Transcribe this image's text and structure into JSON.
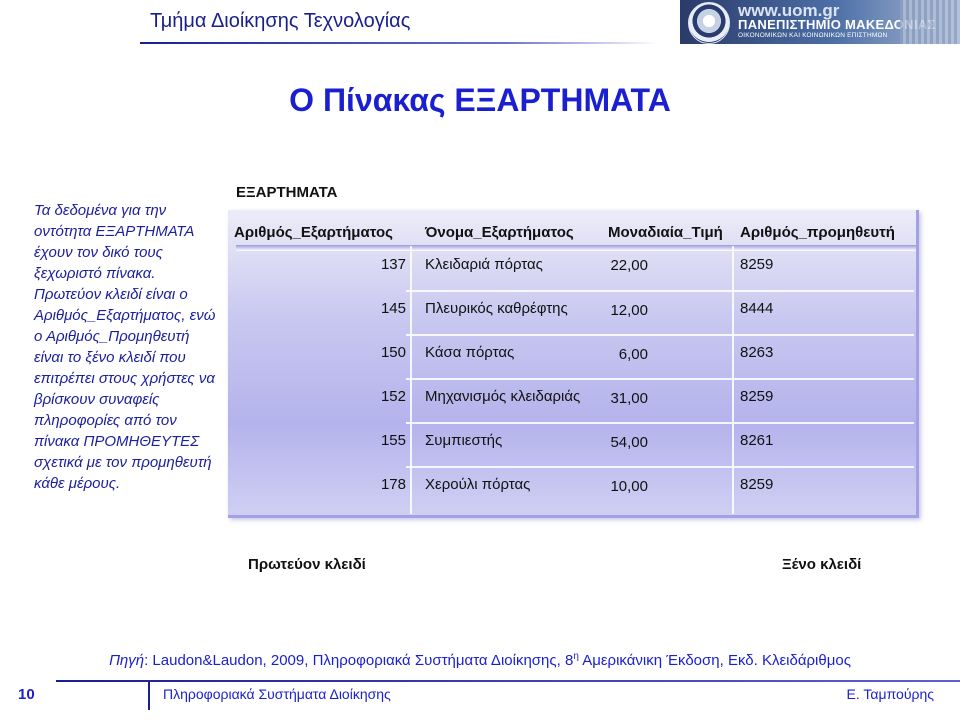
{
  "header": {
    "department": "Τμήμα Διοίκησης Τεχνολογίας",
    "logo": {
      "url": "www.uom.gr",
      "name": "ΠΑΝΕΠΙΣΤΗΜΙΟ ΜΑΚΕΔΟΝΙΑΣ",
      "subtitle": "ΟΙΚΟΝΟΜΙΚΩΝ ΚΑΙ ΚΟΙΝΩΝΙΚΩΝ ΕΠΙΣΤΗΜΩΝ"
    }
  },
  "slide": {
    "title": "Ο Πίνακας ΕΞΑΡΤΗΜΑΤΑ",
    "explanation": "Τα δεδομένα για την οντότητα ΕΞΑΡΤΗΜΑΤΑ έχουν τον δικό τους ξεχωριστό πίνακα. Πρωτεύον κλειδί είναι ο Αριθμός_Εξαρτήματος, ενώ ο Αριθμός_Προμηθευτή είναι το ξένο κλειδί που επιτρέπει στους χρήστες να βρίσκουν συναφείς πληροφορίες από τον πίνακα ΠΡΟΜΗΘΕΥΤΕΣ σχετικά με τον προμηθευτή κάθε μέρους."
  },
  "table": {
    "name": "ΕΞΑΡΤΗΜΑΤΑ",
    "columns": [
      "Αριθμός_Εξαρτήματος",
      "Όνομα_Εξαρτήματος",
      "Μοναδιαία_Τιμή",
      "Αριθμός_προμηθευτή"
    ],
    "rows": [
      {
        "part_no": "137",
        "part_name": "Κλειδαριά πόρτας",
        "unit_price": "22,00",
        "supplier_no": "8259"
      },
      {
        "part_no": "145",
        "part_name": "Πλευρικός καθρέφτης",
        "unit_price": "12,00",
        "supplier_no": "8444"
      },
      {
        "part_no": "150",
        "part_name": "Κάσα πόρτας",
        "unit_price": "6,00",
        "supplier_no": "8263"
      },
      {
        "part_no": "152",
        "part_name": "Μηχανισμός κλειδαριάς",
        "unit_price": "31,00",
        "supplier_no": "8259"
      },
      {
        "part_no": "155",
        "part_name": "Συμπιεστής",
        "unit_price": "54,00",
        "supplier_no": "8261"
      },
      {
        "part_no": "178",
        "part_name": "Χερούλι πόρτας",
        "unit_price": "10,00",
        "supplier_no": "8259"
      }
    ],
    "primary_key_label": "Πρωτεύον κλειδί",
    "foreign_key_label": "Ξένο κλειδί"
  },
  "source": {
    "label": "Πηγή",
    "text": ": Laudon&Laudon, 2009, Πληροφοριακά Συστήματα Διοίκησης, 8",
    "superscript": "η",
    "text_after": " Αμερικάνικη Έκδοση, Εκδ. Κλειδάριθμος"
  },
  "footer": {
    "page_number": "10",
    "course": "Πληροφοριακά Συστήματα Διοίκησης",
    "author": "Ε. Ταμπούρης"
  }
}
